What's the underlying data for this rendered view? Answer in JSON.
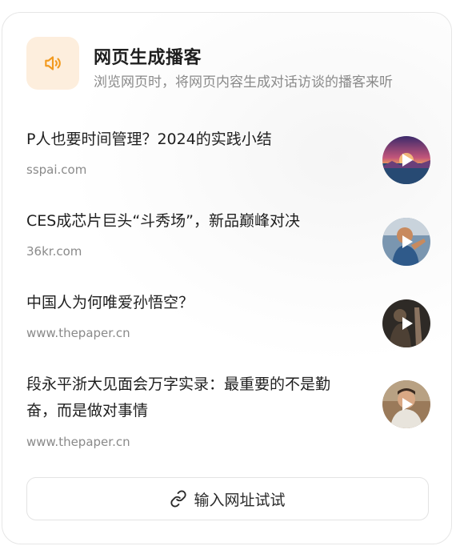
{
  "header": {
    "title": "网页生成播客",
    "subtitle": "浏览网页时，将网页内容生成对话访谈的播客来听",
    "logo_icon": "speaker-icon",
    "accent": "#f29a1f"
  },
  "items": [
    {
      "title": "P人也要时间管理？2024的实践小结",
      "source": "sspai.com",
      "thumb_icon": "play-icon"
    },
    {
      "title": "CES成芯片巨头“斗秀场”，新品巅峰对决",
      "source": "36kr.com",
      "thumb_icon": "play-icon"
    },
    {
      "title": "中国人为何唯爱孙悟空？",
      "source": "www.thepaper.cn",
      "thumb_icon": "play-icon"
    },
    {
      "title": "段永平浙大见面会万字实录：最重要的不是勤奋，而是做对事情",
      "source": "www.thepaper.cn",
      "thumb_icon": "play-icon"
    }
  ],
  "try_button": {
    "label": "输入网址试试",
    "icon": "link-icon"
  }
}
